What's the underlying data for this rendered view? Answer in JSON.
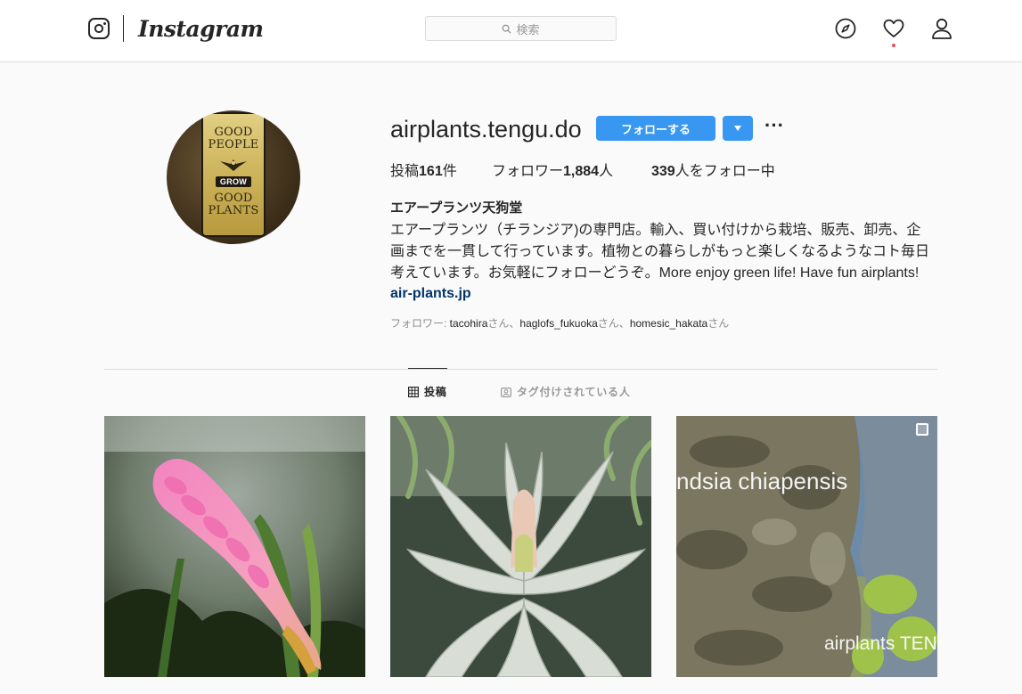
{
  "nav": {
    "wordmark": "Instagram",
    "search_placeholder": "検索",
    "icons": [
      "camera-logo-icon",
      "search-icon",
      "compass-icon",
      "heart-icon",
      "user-icon"
    ]
  },
  "profile": {
    "username": "airplants.tengu.do",
    "follow_label": "フォローする",
    "more_label": "···",
    "stats": {
      "posts_prefix": "投稿",
      "posts_count": "161",
      "posts_suffix": "件",
      "followers_prefix": "フォロワー",
      "followers_count": "1,884",
      "followers_suffix": "人",
      "following_count": "339",
      "following_suffix": "人をフォロー中"
    },
    "full_name": "エアープランツ天狗堂",
    "bio_lines": [
      "エアープランツ（チランジア)の専門店。輸入、買い付けから栽培、販売、卸売、企",
      "画までを一貫して行っています。植物との暮らしがもっと楽しくなるようなコト毎日",
      "考えています。お気軽にフォローどうぞ。More enjoy green life! Have fun airplants!"
    ],
    "link": "air-plants.jp",
    "followed_by": {
      "prefix": "フォロワー: ",
      "user1": "tacohira",
      "sep1": "さん、",
      "user2": "haglofs_fukuoka",
      "sep2": "さん、",
      "user3": "homesic_hakata",
      "suffix": "さん"
    },
    "avatar_text": {
      "line1": "GOOD",
      "line2": "PEOPLE",
      "badge": "GROW",
      "line3": "GOOD",
      "line4": "PLANTS"
    }
  },
  "tabs": [
    {
      "label": "投稿",
      "icon": "grid-icon",
      "active": true
    },
    {
      "label": "タグ付けされている人",
      "icon": "tagged-icon",
      "active": false
    }
  ],
  "posts": [
    {
      "subject": "pink-bloom",
      "overlay": ""
    },
    {
      "subject": "silver-airplant",
      "overlay": ""
    },
    {
      "subject": "rock-cliff",
      "overlay_top": "ndsia chiapensis",
      "overlay_bottom": "airplants TENG",
      "multi": true
    }
  ],
  "colors": {
    "accent": "#3897f0",
    "link": "#003569",
    "notification": "#ed4956"
  }
}
